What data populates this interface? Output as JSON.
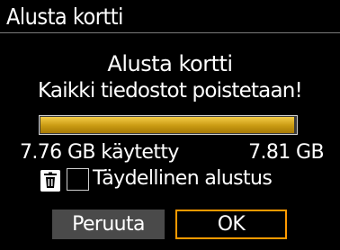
{
  "window": {
    "title": "Alusta kortti"
  },
  "dialog": {
    "heading": "Alusta kortti",
    "message": "Kaikki tiedostot poistetaan!"
  },
  "storage": {
    "used_label": "7.76 GB käytetty",
    "total_label": "7.81 GB",
    "used_gb": 7.76,
    "total_gb": 7.81,
    "usage_fraction": 0.9936
  },
  "low_level_format": {
    "icon": "trash-icon",
    "label": "Täydellinen alustus",
    "checked": false
  },
  "buttons": {
    "cancel_label": "Peruuta",
    "ok_label": "OK",
    "selected": "ok"
  },
  "colors": {
    "background": "#000000",
    "text": "#ffffff",
    "progress_fill": "#d4a418",
    "selection_border": "#ff9a00",
    "button_gray": "#4a4a4a"
  }
}
